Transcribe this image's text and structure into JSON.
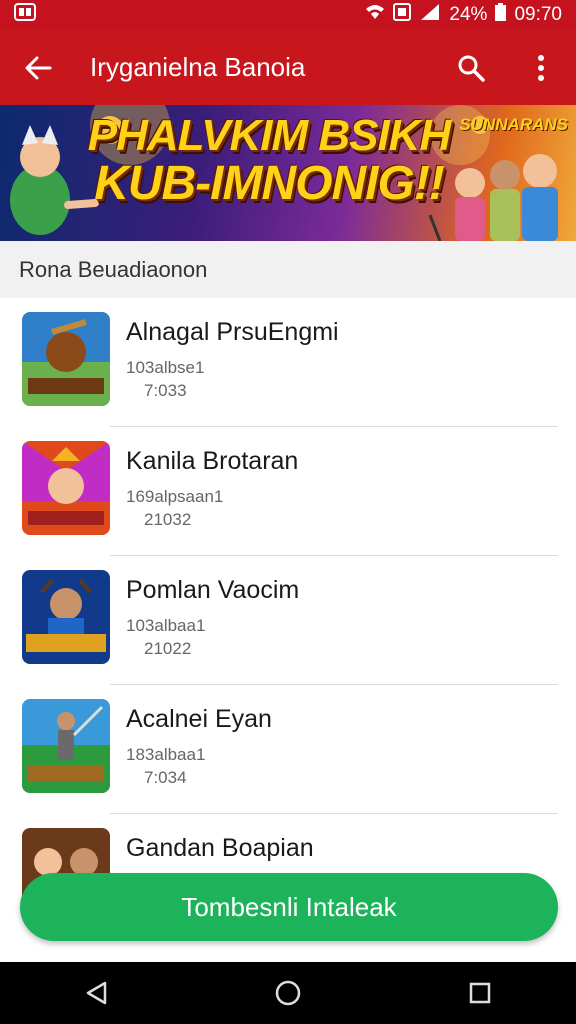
{
  "status_bar": {
    "battery": "24%",
    "time": "09:70"
  },
  "app_bar": {
    "title": "Iryganielna Banoia",
    "icons": [
      "back-arrow-icon",
      "search-icon",
      "more-vert-icon"
    ]
  },
  "banner": {
    "line1": "PHALVKIM BSIKH",
    "line2": "KUB-IMNONIG!!",
    "tag": "SUNNARANS"
  },
  "section": {
    "title": "Rona Beuadiaonon"
  },
  "games": [
    {
      "name": "Alnagal PrsuEngmi",
      "meta1": "103albse1",
      "meta2": "7:033",
      "icon_colors": [
        "#2f7fc9",
        "#6ab04c",
        "#8a4a1a"
      ]
    },
    {
      "name": "Kanila Brotaran",
      "meta1": "169alpsaan1",
      "meta2": "21032",
      "icon_colors": [
        "#e04a1a",
        "#c12cc4",
        "#f5b323"
      ]
    },
    {
      "name": "Pomlan Vaocim",
      "meta1": "103albaa1",
      "meta2": "21022",
      "icon_colors": [
        "#123a8a",
        "#1f66c8",
        "#e0a020"
      ]
    },
    {
      "name": "Acalnei Eyan",
      "meta1": "183albaa1",
      "meta2": "7:034",
      "icon_colors": [
        "#3a9ad9",
        "#2e9a3e",
        "#a06a20"
      ]
    },
    {
      "name": "Gandan Boapian",
      "meta1": "",
      "meta2": "",
      "icon_colors": [
        "#6b3a1a",
        "#2a6ac8",
        "#f0a020"
      ]
    }
  ],
  "install_button": {
    "label": "Tombesnli Intaleak",
    "color": "#1db35a"
  },
  "colors": {
    "app_bar": "#c8161d",
    "status_bar": "#c4121f"
  }
}
